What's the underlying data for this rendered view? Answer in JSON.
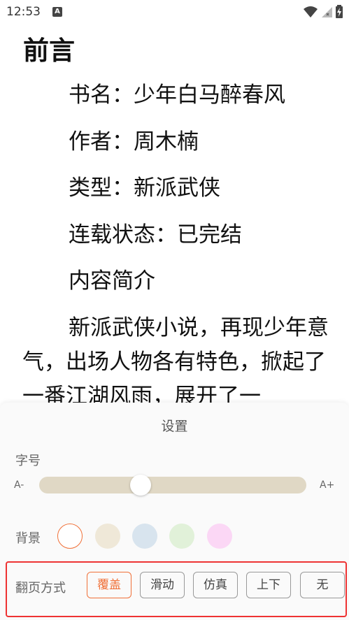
{
  "status_bar": {
    "time": "12:53",
    "notification_icon": "A"
  },
  "content": {
    "chapter_title": "前言",
    "lines": [
      "书名：少年白马醉春风",
      "作者：周木楠",
      "类型：新派武侠",
      "连载状态：已完结",
      "内容简介"
    ],
    "summary": "新派武侠小说，再现少年意气，出场人物各有特色，掀起了一番江湖风雨，展开了一"
  },
  "settings": {
    "title": "设置",
    "font_size_label": "字号",
    "decrease_label": "A-",
    "increase_label": "A+",
    "font_size_level": 0.38,
    "background_label": "背景",
    "backgrounds": [
      {
        "color": "#ffffff",
        "selected": true
      },
      {
        "color": "#efe8d8",
        "selected": false
      },
      {
        "color": "#d8e4ee",
        "selected": false
      },
      {
        "color": "#e1f1d9",
        "selected": false
      },
      {
        "color": "#fbd7f5",
        "selected": false
      }
    ],
    "page_turn_label": "翻页方式",
    "page_turn_options": [
      "覆盖",
      "滑动",
      "仿真",
      "上下",
      "无"
    ],
    "page_turn_selected": "覆盖",
    "accent_color": "#f07038"
  }
}
